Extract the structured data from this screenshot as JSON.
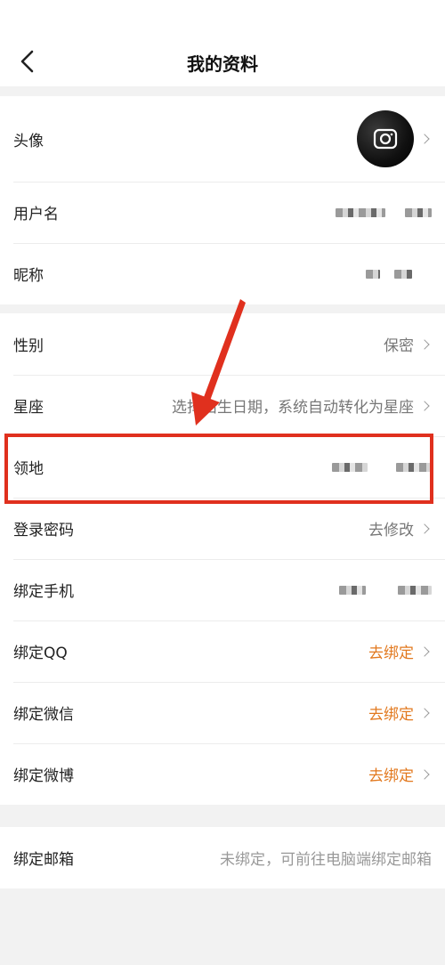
{
  "header": {
    "title": "我的资料"
  },
  "group1": [
    {
      "label": "头像"
    },
    {
      "label": "用户名"
    },
    {
      "label": "昵称"
    }
  ],
  "group2": [
    {
      "label": "性别",
      "value": "保密"
    },
    {
      "label": "星座",
      "value": "选择出生日期，系统自动转化为星座"
    },
    {
      "label": "领地"
    },
    {
      "label": "登录密码",
      "value": "去修改"
    },
    {
      "label": "绑定手机"
    },
    {
      "label": "绑定QQ",
      "value": "去绑定"
    },
    {
      "label": "绑定微信",
      "value": "去绑定"
    },
    {
      "label": "绑定微博",
      "value": "去绑定"
    }
  ],
  "group3": [
    {
      "label": "绑定邮箱",
      "value": "未绑定，可前往电脑端绑定邮箱"
    }
  ],
  "colors": {
    "accent": "#e2791f",
    "highlight": "#e0301e"
  }
}
